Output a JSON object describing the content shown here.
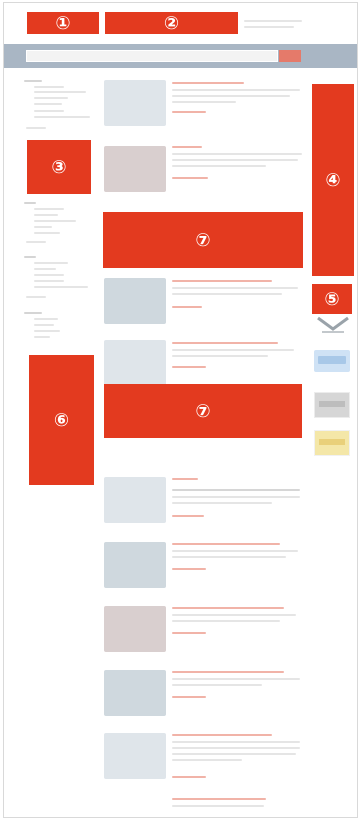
{
  "annotations": [
    {
      "id": "1",
      "label": "①"
    },
    {
      "id": "2",
      "label": "②"
    },
    {
      "id": "3",
      "label": "③"
    },
    {
      "id": "4",
      "label": "④"
    },
    {
      "id": "5",
      "label": "⑤"
    },
    {
      "id": "6",
      "label": "⑥"
    },
    {
      "id": "7a",
      "label": "⑦"
    },
    {
      "id": "7b",
      "label": "⑦"
    }
  ],
  "search": {
    "placeholder": "",
    "button_label": ""
  },
  "colors": {
    "annotation": "#e33a1f",
    "search_bar": "#a9b6c4",
    "link": "#f1b3a8"
  }
}
